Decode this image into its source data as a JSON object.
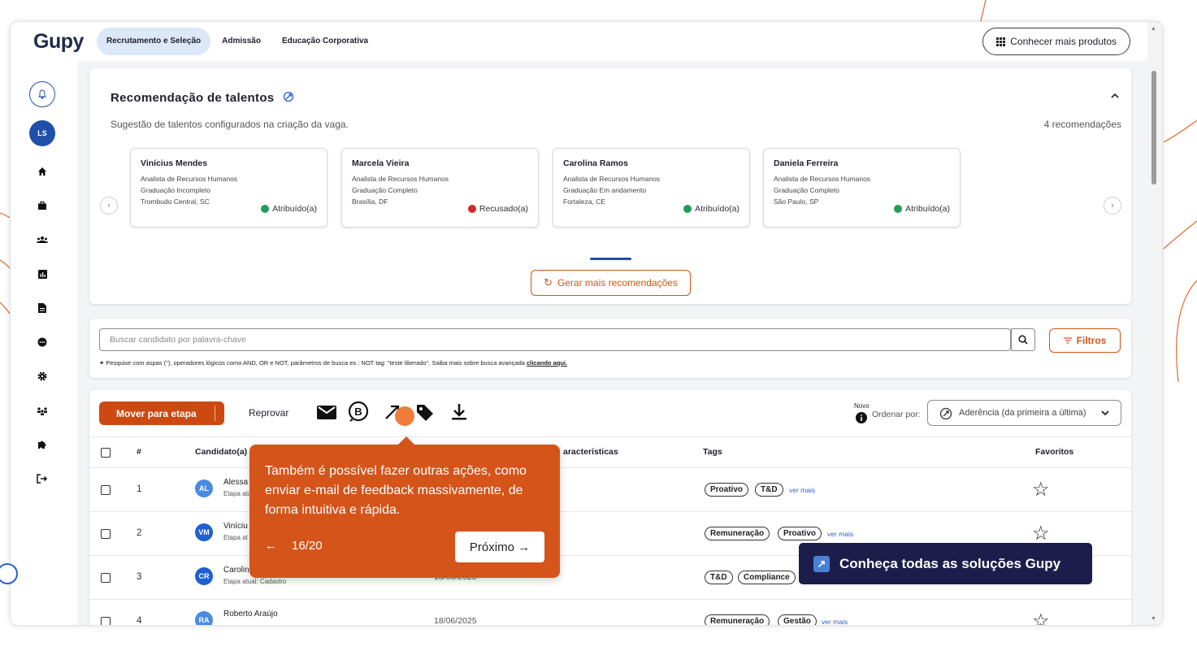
{
  "colors": {
    "brand_orange": "#cc4a12",
    "nav_active_bg": "#dbe8f8",
    "banner_bg": "#1c1d4a",
    "link_blue": "#2a5fd1"
  },
  "topbar": {
    "logo": "Gupy",
    "tabs": [
      {
        "label": "Recrutamento e Seleção"
      },
      {
        "label": "Admissão"
      },
      {
        "label": "Educação Corporativa"
      }
    ],
    "products_button": "Conhecer mais produtos"
  },
  "sidebar": {
    "avatar": "LS",
    "icons": [
      "bell-icon",
      "home-icon",
      "briefcase-icon",
      "users-icon",
      "report-icon",
      "document-icon",
      "chat-icon",
      "gear-icon",
      "people-icon",
      "puzzle-icon",
      "logout-icon"
    ]
  },
  "recommendations": {
    "title": "Recomendação de talentos",
    "subtitle": "Sugestão de talentos configurados na criação da vaga.",
    "count": "4 recomendações",
    "generate_button": "Gerar mais recomendações",
    "candidates": [
      {
        "name": "Vinícius Mendes",
        "role": "Analista de Recursos Humanos",
        "education": "Graduação Incompleto",
        "location": "Trombudo Central, SC",
        "status": "Atribuído(a)",
        "status_color": "#1e9e5a"
      },
      {
        "name": "Marcela Vieira",
        "role": "Analista de Recursos Humanos",
        "education": "Graduação Completo",
        "location": "Brasília, DF",
        "status": "Recusado(a)",
        "status_color": "#d12a2a"
      },
      {
        "name": "Carolina Ramos",
        "role": "Analista de Recursos Humanos",
        "education": "Graduação Em andamento",
        "location": "Fortaleza, CE",
        "status": "Atribuído(a)",
        "status_color": "#1e9e5a"
      },
      {
        "name": "Daniela Ferreira",
        "role": "Analista de Recursos Humanos",
        "education": "Graduação Completo",
        "location": "São Paulo, SP",
        "status": "Atribuído(a)",
        "status_color": "#1e9e5a"
      }
    ]
  },
  "search": {
    "placeholder": "Buscar candidato por palavra-chave",
    "hint": "Pesquise com aspas (\"), operadores lógicos como AND, OR e NOT, parâmetros de busca ex.: NOT tag: \"teste liberado\". Saiba mais sobre busca avançada ",
    "hint_link": "clicando aqui.",
    "filters_button": "Filtros"
  },
  "toolbar": {
    "move_button": "Mover para etapa",
    "reject_button": "Reprovar",
    "new_label": "Novo",
    "sort_label": "Ordenar por:",
    "sort_value": "Aderência (da primeira a última)"
  },
  "table": {
    "headers": {
      "index": "#",
      "candidate": "Candidato(a)",
      "features": "aracterísticas",
      "tags": "Tags",
      "favorites": "Favoritos"
    },
    "rows": [
      {
        "index": "1",
        "initials": "AL",
        "avatar_color": "#4a8be0",
        "name": "Alessa",
        "stage": "",
        "date": "",
        "tags": [
          "Proativo",
          "T&D"
        ],
        "more": "ver mais"
      },
      {
        "index": "2",
        "initials": "VM",
        "avatar_color": "#1f5fd1",
        "name": "Viníciu",
        "stage": "Etapa at",
        "date": "",
        "tags": [
          "Remuneração",
          "Proativo"
        ],
        "more": "ver mais"
      },
      {
        "index": "3",
        "initials": "CR",
        "avatar_color": "#1f5fd1",
        "name": "Carolin",
        "stage": "Etapa atual: Cadastro",
        "date": "18/06/2025",
        "tags": [
          "T&D",
          "Compliance"
        ],
        "more": ""
      },
      {
        "index": "4",
        "initials": "RA",
        "avatar_color": "#4a8be0",
        "name": "Roberto Araújo",
        "stage": "",
        "date": "18/06/2025",
        "tags": [
          "Remuneração",
          "Gestão"
        ],
        "more": "ver mais"
      }
    ],
    "row1_stage": "Etapa atu"
  },
  "popover": {
    "text": "Também é possível fazer outras ações, como enviar e-mail de feedback massivamente, de forma intuitiva e rápida.",
    "back_arrow": "←",
    "progress": "16/20",
    "next_button": "Próximo →"
  },
  "banner": {
    "text": "Conheça todas as soluções Gupy",
    "icon": "↗"
  }
}
